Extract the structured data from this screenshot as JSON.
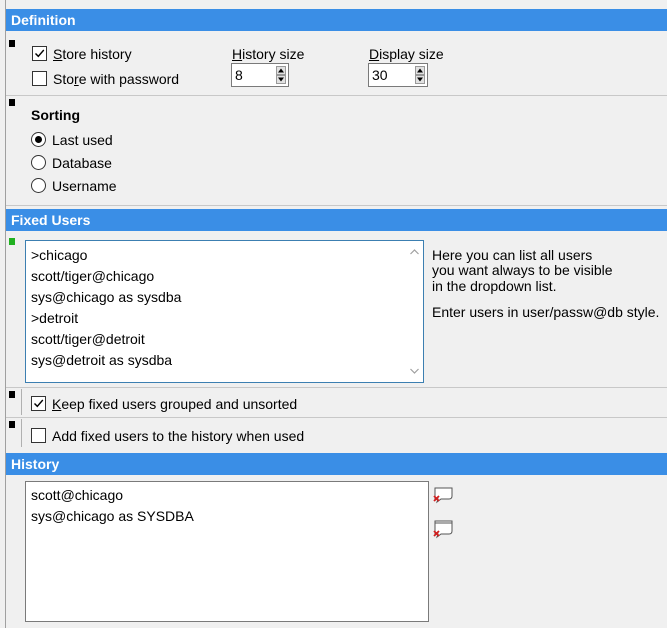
{
  "definition": {
    "header": "Definition",
    "store_history": {
      "label_pre": "",
      "label_ul": "S",
      "label_post": "tore history",
      "checked": true
    },
    "store_with_password": {
      "label_pre": "Sto",
      "label_ul": "r",
      "label_post": "e with password",
      "checked": false
    },
    "history_size": {
      "label_ul": "H",
      "label_post": "istory size",
      "value": "8"
    },
    "display_size": {
      "label_ul": "D",
      "label_post": "isplay size",
      "value": "30"
    }
  },
  "sorting": {
    "title": "Sorting",
    "options": [
      {
        "label": "Last used",
        "selected": true
      },
      {
        "label": "Database",
        "selected": false
      },
      {
        "label": "Username",
        "selected": false
      }
    ]
  },
  "fixed_users": {
    "header": "Fixed Users",
    "items": [
      ">chicago",
      "scott/tiger@chicago",
      "sys@chicago as sysdba",
      ">detroit",
      "scott/tiger@detroit",
      "sys@detroit as sysdba"
    ],
    "help_lines": [
      "Here you can list all users",
      "you want always to be visible",
      "in the dropdown list."
    ],
    "help_note": "Enter users in user/passw@db style.",
    "keep_grouped": {
      "label_ul": "K",
      "label_post": "eep fixed users grouped and unsorted",
      "checked": true
    },
    "add_to_history": {
      "label": "Add fixed users to the history when used",
      "checked": false
    }
  },
  "history": {
    "header": "History",
    "items": [
      "scott@chicago",
      "sys@chicago as SYSDBA"
    ],
    "icons": [
      "delete-item-icon",
      "delete-all-icon"
    ]
  },
  "colors": {
    "header_bg": "#3a8ee6",
    "marker_black": "#000000",
    "marker_green": "#20b020",
    "focus_border": "#3c7fb1"
  }
}
